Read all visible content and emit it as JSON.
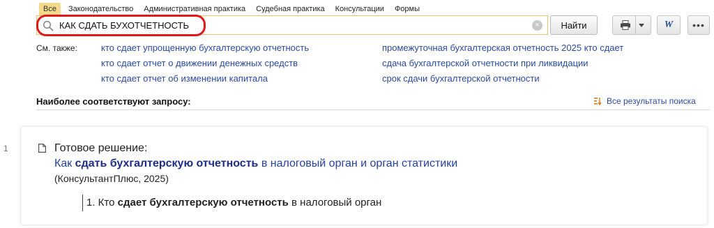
{
  "tabs": [
    {
      "label": "Все",
      "active": true
    },
    {
      "label": "Законодательство"
    },
    {
      "label": "Административная практика"
    },
    {
      "label": "Судебная практика"
    },
    {
      "label": "Консультации"
    },
    {
      "label": "Формы"
    }
  ],
  "search": {
    "value": "КАК СДАТЬ БУХОТЧЕТНОСТЬ",
    "button_label": "Найти"
  },
  "toolbar": {
    "word_label": "W",
    "more_label": "•••"
  },
  "see_also": {
    "label": "См. также:",
    "col1": [
      "кто сдает упрощенную бухгалтерскую отчетность",
      "кто сдает отчет о движении денежных средств",
      "кто сдает отчет об изменении капитала"
    ],
    "col2": [
      "промежуточная бухгалтерская отчетность 2025 кто сдает",
      "сдача бухгалтерской отчетности при ликвидации",
      "срок сдачи бухгалтерской отчетности"
    ]
  },
  "results": {
    "heading": "Наиболее соответствуют запросу:",
    "all_results_label": "Все результаты поиска",
    "items": [
      {
        "number": "1",
        "type": "Готовое решение:",
        "title_prefix": "Как ",
        "title_bold": "сдать бухгалтерскую отчетность",
        "title_suffix": " в налоговый орган и орган статистики",
        "source": "(КонсультантПлюс, 2025)",
        "snippet_prefix": "1. Кто ",
        "snippet_bold1": "сдает",
        "snippet_mid": " ",
        "snippet_bold2": "бухгалтерскую отчетность",
        "snippet_suffix": " в налоговый орган"
      }
    ]
  },
  "colors": {
    "accent": "#f5d98a",
    "link": "#2b49a3",
    "highlight": "#e01818"
  }
}
